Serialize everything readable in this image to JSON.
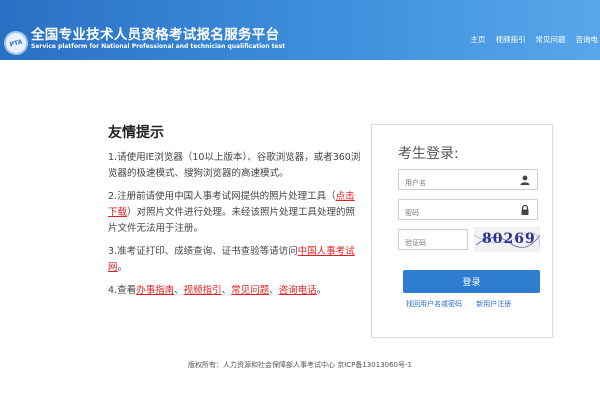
{
  "header": {
    "logo_text": "PTA",
    "title": "全国专业技术人员资格考试报名服务平台",
    "subtitle": "Service platform for National Professional and technician qualification test",
    "nav": [
      "主页",
      "视频指引",
      "常见问题",
      "咨询电"
    ]
  },
  "notice": {
    "title": "友情提示",
    "p1": "1.请使用IE浏览器（10以上版本）、谷歌浏览器，或者360浏览器的极速模式、搜狗浏览器的高速模式。",
    "p2_before": "2.注册前请使用中国人事考试网提供的照片处理工具（",
    "p2_link": "点击下载",
    "p2_after": "）对照片文件进行处理。未经该照片处理工具处理的照片文件无法用于注册。",
    "p3_before": "3.准考证打印、成绩查询、证书查验等请访问",
    "p3_link": "中国人事考试网",
    "p3_after": "。",
    "p4_before": "4.查看",
    "p4_links": [
      "办事指南",
      "视频指引",
      "常见问题",
      "咨询电话"
    ],
    "p4_after": "。",
    "separator": "、"
  },
  "login": {
    "title": "考生登录:",
    "username_placeholder": "用户名",
    "password_placeholder": "密码",
    "captcha_placeholder": "验证码",
    "captcha_text": "80269",
    "button": "登录",
    "link_forgot": "找回用户名或密码",
    "link_register": "新用户注册"
  },
  "footer": {
    "text": "版权所有：人力资源和社会保障部人事考试中心 京ICP备13013060号-1"
  },
  "colors": {
    "header_blue": "#2a70c4",
    "button_blue": "#2e7dd0",
    "link_red": "#e02020"
  }
}
